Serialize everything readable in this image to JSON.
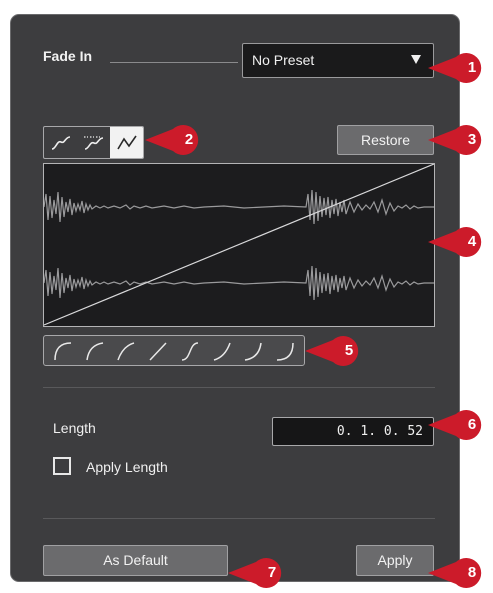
{
  "dialog": {
    "title": "Fade In"
  },
  "preset": {
    "value": "No Preset",
    "arrow_icon": "triangle-down-icon"
  },
  "curve_kind": {
    "icons": [
      "spline-curve-icon",
      "damped-spline-curve-icon",
      "linear-curve-icon"
    ],
    "selected_index": 2
  },
  "restore": {
    "label": "Restore"
  },
  "display": {
    "waveform_color": "#9a9a9c",
    "curve_color": "#d8d8da"
  },
  "shapes": {
    "icons": [
      "curve-shape-1-icon",
      "curve-shape-2-icon",
      "curve-shape-3-icon",
      "curve-shape-4-icon",
      "curve-shape-5-icon",
      "curve-shape-6-icon",
      "curve-shape-7-icon",
      "curve-shape-8-icon"
    ]
  },
  "length": {
    "label": "Length",
    "value": "0. 1. 0. 52"
  },
  "apply_length": {
    "label": "Apply Length",
    "checked": false
  },
  "buttons": {
    "as_default": "As Default",
    "apply": "Apply"
  },
  "callouts": [
    "1",
    "2",
    "3",
    "4",
    "5",
    "6",
    "7",
    "8"
  ],
  "colors": {
    "callout_red": "#cc1b2a",
    "panel_bg": "#3d3d3f"
  }
}
